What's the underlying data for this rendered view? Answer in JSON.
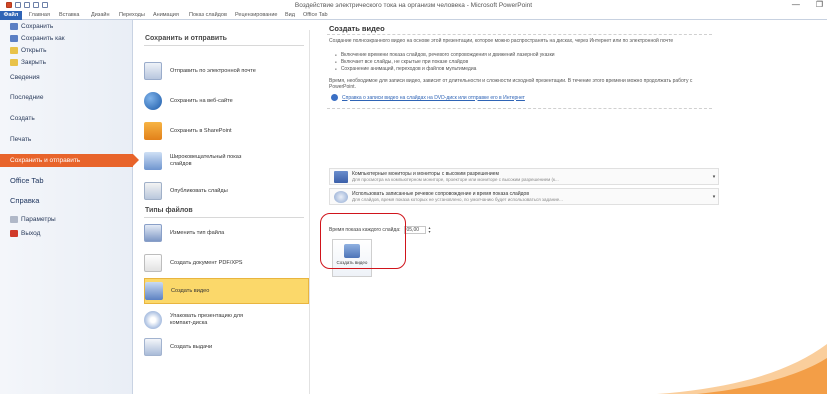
{
  "window": {
    "title": "Воздействие электрического тока на организм человека - Microsoft PowerPoint",
    "minimize": "—",
    "maximize": "❐"
  },
  "ribbon": {
    "tabs": [
      "Файл",
      "Главная",
      "Вставка",
      "Дизайн",
      "Переходы",
      "Анимация",
      "Показ слайдов",
      "Рецензирование",
      "Вид",
      "Office Tab"
    ]
  },
  "nav": {
    "items": [
      {
        "label": "Сохранить",
        "icon": "save-icon"
      },
      {
        "label": "Сохранить как",
        "icon": "save-as-icon"
      },
      {
        "label": "Открыть",
        "icon": "open-folder-icon"
      },
      {
        "label": "Закрыть",
        "icon": "close-folder-icon"
      },
      {
        "label": "Сведения"
      },
      {
        "label": "Последние"
      },
      {
        "label": "Создать"
      },
      {
        "label": "Печать"
      },
      {
        "label": "Сохранить и отправить"
      },
      {
        "label": "Office Tab"
      },
      {
        "label": "Справка"
      },
      {
        "label": "Параметры",
        "icon": "options-icon"
      },
      {
        "label": "Выход",
        "icon": "exit-icon"
      }
    ]
  },
  "middle": {
    "section1": "Сохранить и отправить",
    "options1": [
      {
        "label": "Отправить по электронной почте",
        "icon": "email-icon"
      },
      {
        "label": "Сохранить на веб-сайте",
        "icon": "globe-icon"
      },
      {
        "label": "Сохранить в SharePoint",
        "icon": "sharepoint-icon"
      },
      {
        "label": "Широковещательный показ слайдов",
        "icon": "broadcast-icon"
      },
      {
        "label": "Опубликовать слайды",
        "icon": "publish-icon"
      }
    ],
    "section2": "Типы файлов",
    "options2": [
      {
        "label": "Изменить тип файла",
        "icon": "file-type-icon"
      },
      {
        "label": "Создать документ PDF/XPS",
        "icon": "pdf-icon"
      },
      {
        "label": "Создать видео",
        "icon": "video-icon"
      },
      {
        "label": "Упаковать презентацию для компакт-диска",
        "icon": "cd-icon"
      },
      {
        "label": "Создать выдачи",
        "icon": "handouts-icon"
      }
    ]
  },
  "right": {
    "title": "Создать видео",
    "intro": "Создание полноэкранного видео на основе этой презентации, которое можно распространять на дисках, через Интернет или по электронной почте",
    "bullets": [
      "Включение времени показа слайдов, речевого сопровождения и движений лазерной указки",
      "Включает все слайды, не скрытые при показе слайдов",
      "Сохранение анимаций, переходов и файлов мультимедиа"
    ],
    "time_note": "Время, необходимое для записи видео, зависит от длительности и сложности исходной презентации. В течение этого времени можно продолжать работу с PowerPoint.",
    "help_link": "Справка о записи видео на слайдах на DVD-диск или отправке его в Интернет",
    "combo1": {
      "main": "Компьютерные мониторы и мониторы с высоким разрешением",
      "sub": "Для просмотра на компьютерном мониторе, проекторе или мониторе с высоким разрешением (к..."
    },
    "combo2": {
      "main": "Использовать записанные речевое сопровождение и время показа слайдов",
      "sub": "Для слайдов, время показа которых не установлено, по умолчанию будет использоваться задание..."
    },
    "seconds_label": "Время показа каждого слайда:",
    "seconds_value": "05,00",
    "create_button": "Создать видео"
  },
  "colors": {
    "accent": "#2f64b6",
    "active_nav": "#e8642b",
    "selected_option": "#fbd86a",
    "highlight_ring": "#d0141b"
  }
}
